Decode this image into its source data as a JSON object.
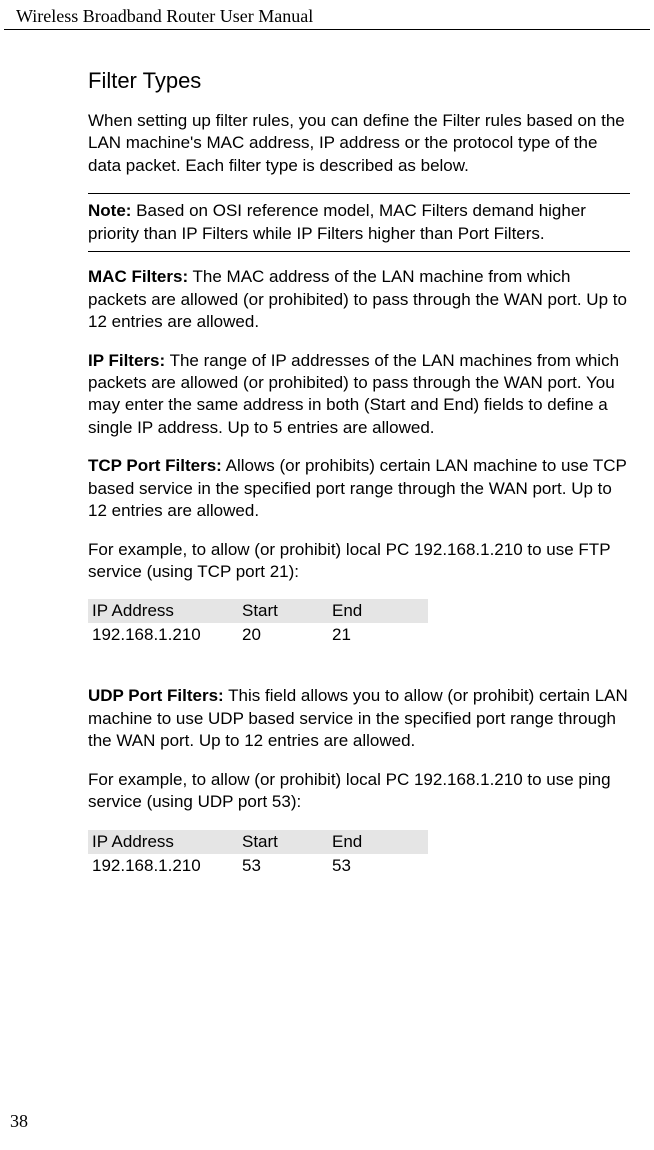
{
  "running_head": "Wireless Broadband Router User Manual",
  "page_number": "38",
  "section_title": "Filter Types",
  "intro": "When setting up filter rules, you can define the Filter rules based on the LAN machine's MAC address, IP address or the protocol type of the data packet. Each filter type is described as below.",
  "note": {
    "label": "Note:",
    "text": " Based on OSI reference model, MAC Filters demand higher priority than IP Filters while IP Filters higher than Port Filters."
  },
  "mac": {
    "label": "MAC Filters:",
    "text": " The MAC address of the LAN machine from which packets are allowed (or prohibited) to pass through the WAN port. Up to 12 entries are allowed."
  },
  "ip": {
    "label": "IP Filters:",
    "text": " The range of IP addresses of the LAN machines from which packets are allowed (or prohibited) to pass through the WAN port. You may enter the same address in both (Start and End) fields to define a single IP address. Up to 5 entries are allowed."
  },
  "tcp": {
    "label": "TCP Port Filters:",
    "text": " Allows (or prohibits) certain LAN machine to use TCP based service in the specified port range through the WAN port. Up to 12 entries are allowed."
  },
  "tcp_example_intro": "For example, to allow (or prohibit) local PC 192.168.1.210 to use FTP service (using TCP port 21):",
  "table_headers": {
    "c1": "IP Address",
    "c2": "Start",
    "c3": "End"
  },
  "tcp_row": {
    "ip": "192.168.1.210",
    "start": "20",
    "end": "21"
  },
  "udp": {
    "label": "UDP Port Filters:",
    "text": " This field allows you to allow (or prohibit) certain LAN machine to use UDP based service in the specified port range through the WAN port. Up to 12 entries are allowed."
  },
  "udp_example_intro": "For example, to allow (or prohibit) local PC 192.168.1.210 to use ping service (using UDP port 53):",
  "udp_row": {
    "ip": "192.168.1.210",
    "start": "53",
    "end": "53"
  }
}
